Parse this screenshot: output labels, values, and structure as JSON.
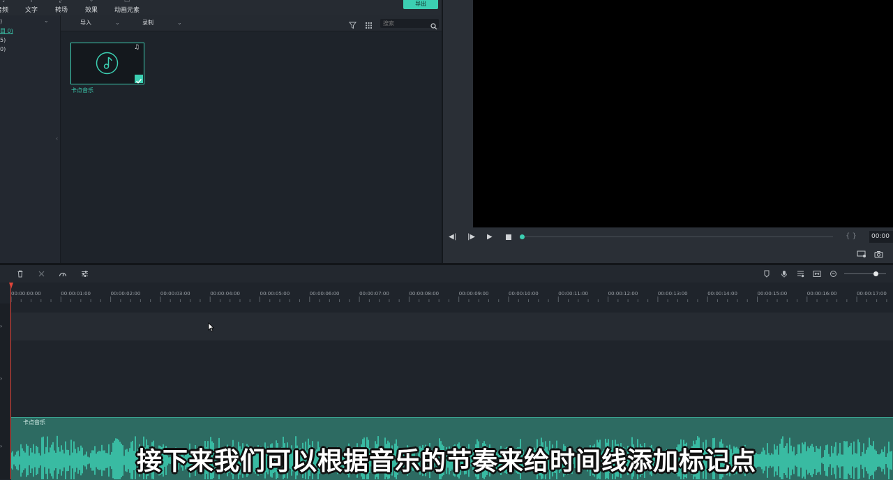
{
  "toolbar": {
    "tools": [
      {
        "label": "音频",
        "icon": "music-note-icon"
      },
      {
        "label": "文字",
        "icon": "text-icon"
      },
      {
        "label": "转场",
        "icon": "transition-icon"
      },
      {
        "label": "效果",
        "icon": "effects-icon"
      },
      {
        "label": "动画元素",
        "icon": "elements-icon"
      }
    ],
    "export_label": "导出"
  },
  "folders": [
    ")",
    "目 0)",
    "5)",
    "0)"
  ],
  "media": {
    "import_label": "导入",
    "record_label": "录制",
    "search_placeholder": "搜索",
    "item_label": "卡点音乐"
  },
  "preview": {
    "timecode": "00:00"
  },
  "timeline": {
    "ruler_labels": [
      "00:00:00:00",
      "00:00:01:00",
      "00:00:02:00",
      "00:00:03:00",
      "00:00:04:00",
      "00:00:05:00",
      "00:00:06:00",
      "00:00:07:00",
      "00:00:08:00",
      "00:00:09:00",
      "00:00:10:00",
      "00:00:11:00",
      "00:00:12:00",
      "00:00:13:00",
      "00:00:14:00",
      "00:00:15:00",
      "00:00:16:00",
      "00:00:17:00"
    ],
    "audio_clip_label": "卡点音乐"
  },
  "subtitle": "接下来我们可以根据音乐的节奏来给时间线添加标记点",
  "colors": {
    "accent": "#3ccfb2",
    "playhead": "#e0453a",
    "audio_clip": "#2d6b62"
  }
}
